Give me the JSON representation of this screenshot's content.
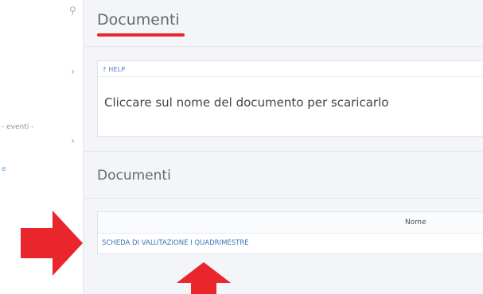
{
  "sidebar": {
    "events_label": "- eventi -",
    "link_fragment": "e"
  },
  "header": {
    "title": "Documenti"
  },
  "help": {
    "label": "? HELP",
    "text": "Cliccare sul nome del documento per scaricarlo"
  },
  "documents": {
    "section_title": "Documenti",
    "column_header": "Nome",
    "rows": [
      {
        "name": "SCHEDA DI VALUTAZIONE I QUADRIMESTRE"
      }
    ]
  },
  "colors": {
    "accent_underline": "#e8262b",
    "annotation_arrow": "#e8262b",
    "link": "#3d74b8"
  }
}
